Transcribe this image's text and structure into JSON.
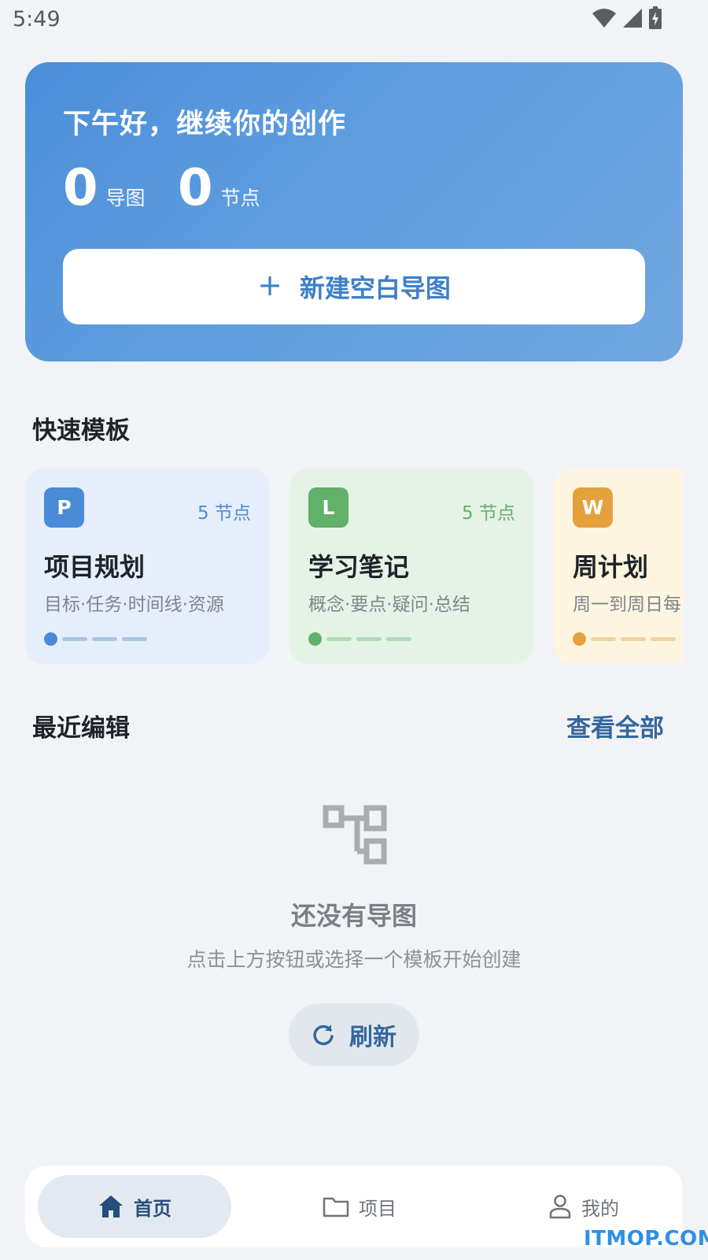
{
  "status_bar": {
    "time": "5:49",
    "icons": [
      "wifi-icon",
      "signal-icon",
      "battery-charging-icon"
    ]
  },
  "hero": {
    "greeting": "下午好，继续你的创作",
    "stats": [
      {
        "value": "0",
        "unit": "导图"
      },
      {
        "value": "0",
        "unit": "节点"
      }
    ],
    "new_button_icon": "+",
    "new_button_label": "新建空白导图"
  },
  "templates": {
    "title": "快速模板",
    "items": [
      {
        "badge": "P",
        "count": "5 节点",
        "title": "项目规划",
        "desc": "目标·任务·时间线·资源",
        "color": "#4a8bd7"
      },
      {
        "badge": "L",
        "count": "5 节点",
        "title": "学习笔记",
        "desc": "概念·要点·疑问·总结",
        "color": "#62b06a"
      },
      {
        "badge": "W",
        "count": "",
        "title": "周计划",
        "desc": "周一到周日每",
        "color": "#e4a13d"
      }
    ]
  },
  "recent": {
    "title": "最近编辑",
    "see_all": "查看全部",
    "empty_icon": "mindmap-icon",
    "empty_title": "还没有导图",
    "empty_subtitle": "点击上方按钮或选择一个模板开始创建",
    "refresh_label": "刷新"
  },
  "nav": {
    "items": [
      {
        "label": "首页",
        "icon": "home-icon",
        "active": true
      },
      {
        "label": "项目",
        "icon": "folder-icon",
        "active": false
      },
      {
        "label": "我的",
        "icon": "user-icon",
        "active": false
      }
    ]
  },
  "watermark": "ITMOP.COM"
}
